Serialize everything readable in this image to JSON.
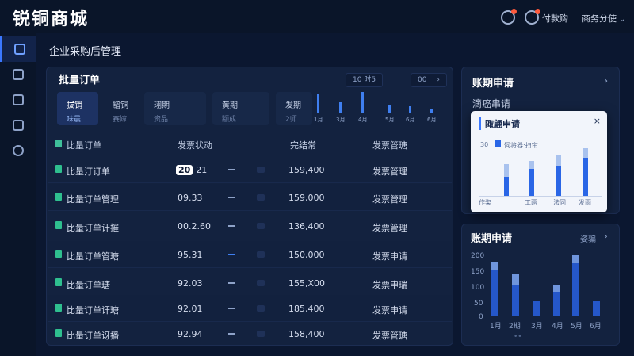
{
  "app": {
    "brand": "锐铜商城",
    "page_title": "企业采购后管理"
  },
  "topbar": {
    "pay_label": "付款购",
    "user_label": "商务分使",
    "user_chevron": "⌄"
  },
  "sidebar": {
    "items": [
      "home-icon",
      "grid-icon",
      "list-icon",
      "folder-icon",
      "settings-icon"
    ]
  },
  "orders_panel": {
    "title": "批量订单",
    "chip_left": "10 时5",
    "chip_right": "00",
    "chip_arrow": "›",
    "tabs": [
      {
        "label": "拔销",
        "sub": "味晨"
      },
      {
        "label": "黯铜",
        "sub": "赛嫁"
      },
      {
        "label": "珝期",
        "sub": "资品"
      },
      {
        "label": "黄期",
        "sub": "颛成"
      },
      {
        "label": "发期",
        "sub": "2师"
      }
    ],
    "mini_chart": {
      "labels": [
        "1月",
        "3月",
        "4月",
        "5月",
        "6月",
        "6月"
      ],
      "values": [
        9,
        5,
        10,
        4,
        3,
        2
      ]
    },
    "table": {
      "headers": [
        "比量订单",
        "发票状动",
        "完结常",
        "发票管瑭"
      ],
      "rows": [
        {
          "name": "比量汀订单",
          "badge": "20",
          "code": "21",
          "amount": "159,400",
          "status": "发票管理"
        },
        {
          "name": "比量订单管理",
          "badge": "",
          "code": "09.33",
          "amount": "159,000",
          "status": "发票管理"
        },
        {
          "name": "比量订单讦摧",
          "badge": "",
          "code": "00.2.60",
          "amount": "136,400",
          "status": "发票管理"
        },
        {
          "name": "比量订单管瑭",
          "badge": "",
          "code": "95.31",
          "amount": "150,000",
          "status": "发票申请"
        },
        {
          "name": "比量订单瑭",
          "badge": "",
          "code": "92.03",
          "amount": "155,X00",
          "status": "发票申瑞"
        },
        {
          "name": "比量订单讦瑭",
          "badge": "",
          "code": "92.01",
          "amount": "185,400",
          "status": "发票申请"
        },
        {
          "name": "比量订单讶播",
          "badge": "",
          "code": "92.94",
          "amount": "158,400",
          "status": "发票管瑭"
        }
      ]
    }
  },
  "period_panel": {
    "title": "账期申请",
    "arrow": "›",
    "subtitle": "滴癌串请",
    "popup": {
      "title": "陬翩申请",
      "close": "×",
      "legend": "饲将器:扫帘",
      "y_label": "30",
      "categories": [
        "作栥",
        "工两",
        "法同",
        "发雨"
      ]
    }
  },
  "period_panel2": {
    "title": "账期申请",
    "link": "姿骗",
    "arrow": "›",
    "dots": "••"
  },
  "chart_data": [
    {
      "type": "bar",
      "categories": [
        "1月",
        "3月",
        "4月",
        "5月",
        "6月",
        "6月"
      ],
      "values": [
        9,
        5,
        10,
        4,
        3,
        2
      ]
    },
    {
      "type": "bar",
      "categories": [
        "作栥",
        "工两",
        "法同",
        "发雨"
      ],
      "series": [
        {
          "values": [
            12,
            17,
            19,
            24
          ]
        },
        {
          "values": [
            8,
            5,
            7,
            6
          ]
        }
      ],
      "ylim": [
        0,
        30
      ]
    },
    {
      "type": "bar",
      "categories": [
        "1月",
        "2期",
        "3月",
        "4月",
        "5月",
        "6月"
      ],
      "series": [
        {
          "values": [
            145,
            95,
            45,
            75,
            165,
            45
          ]
        },
        {
          "values": [
            25,
            35,
            0,
            20,
            25,
            0
          ]
        }
      ],
      "y_ticks": [
        "200",
        "150",
        "100",
        "50",
        "0"
      ],
      "ylim": [
        0,
        200
      ]
    }
  ]
}
